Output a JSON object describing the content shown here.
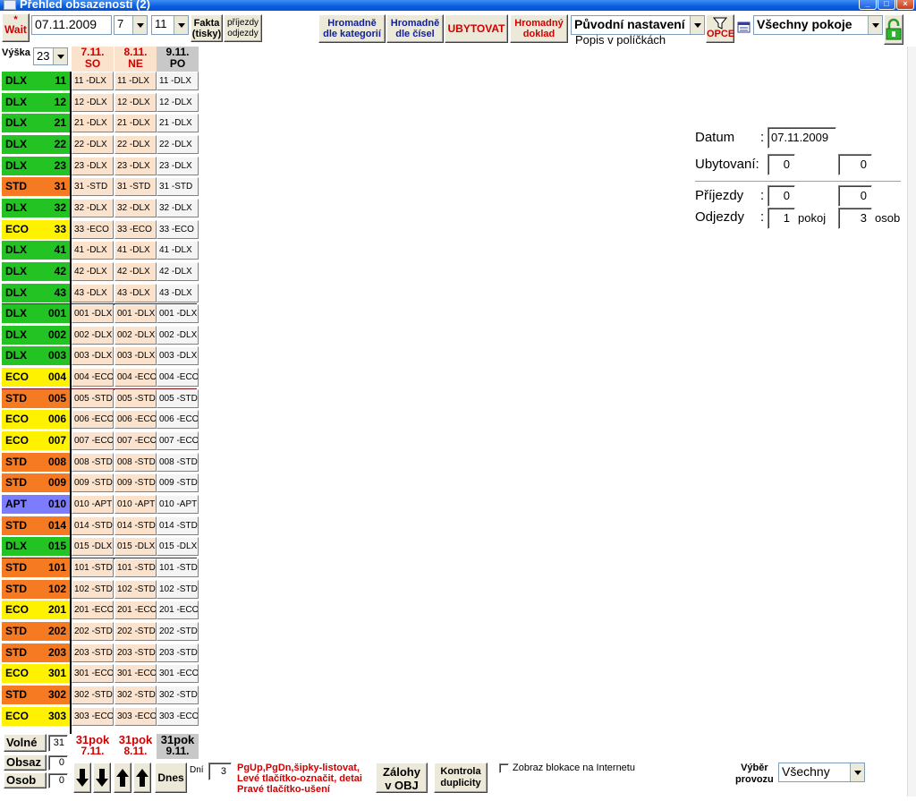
{
  "window": {
    "title": "Přehled obsazenosti (2)"
  },
  "toolbar": {
    "wait_star": "*",
    "wait_label": "Wait",
    "date_value": "07.11.2009",
    "combo_a": "7",
    "combo_b": "11",
    "fakta_line1": "Fakta",
    "fakta_line2": "(tisky)",
    "prijezdy_line1": "příjezdy",
    "prijezdy_line2": "odjezdy",
    "hromadne_kat_line1": "Hromadně",
    "hromadne_kat_line2": "dle kategorií",
    "hromadne_cis_line1": "Hromadně",
    "hromadne_cis_line2": "dle čísel",
    "ubytovat": "UBYTOVAT",
    "hromadny_line1": "Hromadný",
    "hromadny_line2": "doklad",
    "puvodni": "Původní nastavení",
    "popis": "Popis v políčkách",
    "opce": "OPCE",
    "pokoje": "Všechny pokoje"
  },
  "grid": {
    "vyska_label": "Výška",
    "vyska_value": "23",
    "days": [
      {
        "date": "7.11.",
        "dow": "SO",
        "weekend": true
      },
      {
        "date": "8.11.",
        "dow": "NE",
        "weekend": true
      },
      {
        "date": "9.11.",
        "dow": "PO",
        "weekend": false
      }
    ],
    "colors": {
      "DLX": "#22c322",
      "STD": "#f57a22",
      "ECO": "#fff200",
      "APT": "#7c7cff",
      "separator": "#7a1010"
    },
    "rooms": [
      {
        "cat": "DLX",
        "num": "11"
      },
      {
        "cat": "DLX",
        "num": "12"
      },
      {
        "cat": "DLX",
        "num": "21"
      },
      {
        "cat": "DLX",
        "num": "22"
      },
      {
        "cat": "DLX",
        "num": "23"
      },
      {
        "cat": "STD",
        "num": "31"
      },
      {
        "cat": "DLX",
        "num": "32"
      },
      {
        "cat": "ECO",
        "num": "33"
      },
      {
        "cat": "DLX",
        "num": "41"
      },
      {
        "cat": "DLX",
        "num": "42"
      },
      {
        "cat": "DLX",
        "num": "43"
      },
      {
        "cat": "DLX",
        "num": "001"
      },
      {
        "cat": "DLX",
        "num": "002"
      },
      {
        "cat": "DLX",
        "num": "003"
      },
      {
        "cat": "ECO",
        "num": "004"
      },
      {
        "cat": "STD",
        "num": "005"
      },
      {
        "cat": "ECO",
        "num": "006"
      },
      {
        "cat": "ECO",
        "num": "007"
      },
      {
        "cat": "STD",
        "num": "008"
      },
      {
        "cat": "STD",
        "num": "009"
      },
      {
        "cat": "APT",
        "num": "010"
      },
      {
        "cat": "STD",
        "num": "014"
      },
      {
        "cat": "DLX",
        "num": "015"
      },
      {
        "cat": "STD",
        "num": "101"
      },
      {
        "cat": "STD",
        "num": "102"
      },
      {
        "cat": "ECO",
        "num": "201"
      },
      {
        "cat": "STD",
        "num": "202"
      },
      {
        "cat": "STD",
        "num": "203"
      },
      {
        "cat": "ECO",
        "num": "301"
      },
      {
        "cat": "STD",
        "num": "302"
      },
      {
        "cat": "ECO",
        "num": "303"
      }
    ],
    "separators_after": [
      10,
      14,
      22
    ],
    "footer_pok": "31pok",
    "footer_dates": [
      "7.11.",
      "8.11.",
      "9.11."
    ]
  },
  "summary": {
    "volne_label": "Volné",
    "volne_value": "31",
    "obsaz_label": "Obsaz",
    "obsaz_value": "0",
    "osob_label": "Osob",
    "osob_value": "0"
  },
  "info": {
    "datum_label": "Datum",
    "datum_colon": ":",
    "datum_value": "07.11.2009",
    "ubytovani_label": "Ubytovaní:",
    "ubytovani_a": "0",
    "ubytovani_b": "0",
    "prijezdy_label": "Příjezdy",
    "prijezdy_colon": ":",
    "prijezdy_a": "0",
    "prijezdy_b": "0",
    "odjezdy_label": "Odjezdy",
    "odjezdy_colon": ":",
    "odjezdy_a": "1",
    "odjezdy_pokoj": "pokoj",
    "odjezdy_b": "3",
    "odjezdy_osob": "osob"
  },
  "bottom": {
    "dnes": "Dnes",
    "dni_label": "Dní",
    "dni_value": "3",
    "help_line1": "PgUp,PgDn,šipky-listovat,",
    "help_line2": "Levé tlačítko-označit, detai",
    "help_line3": "Pravé tlačítko-ušení",
    "zalohy_line1": "Zálohy",
    "zalohy_line2": "v OBJ",
    "kontrola_line1": "Kontrola",
    "kontrola_line2": "duplicity",
    "zobraz_label": "Zobraz blokace na Internetu",
    "vyber_line1": "Výběr",
    "vyber_line2": "provozu",
    "provoz_value": "Všechny"
  }
}
